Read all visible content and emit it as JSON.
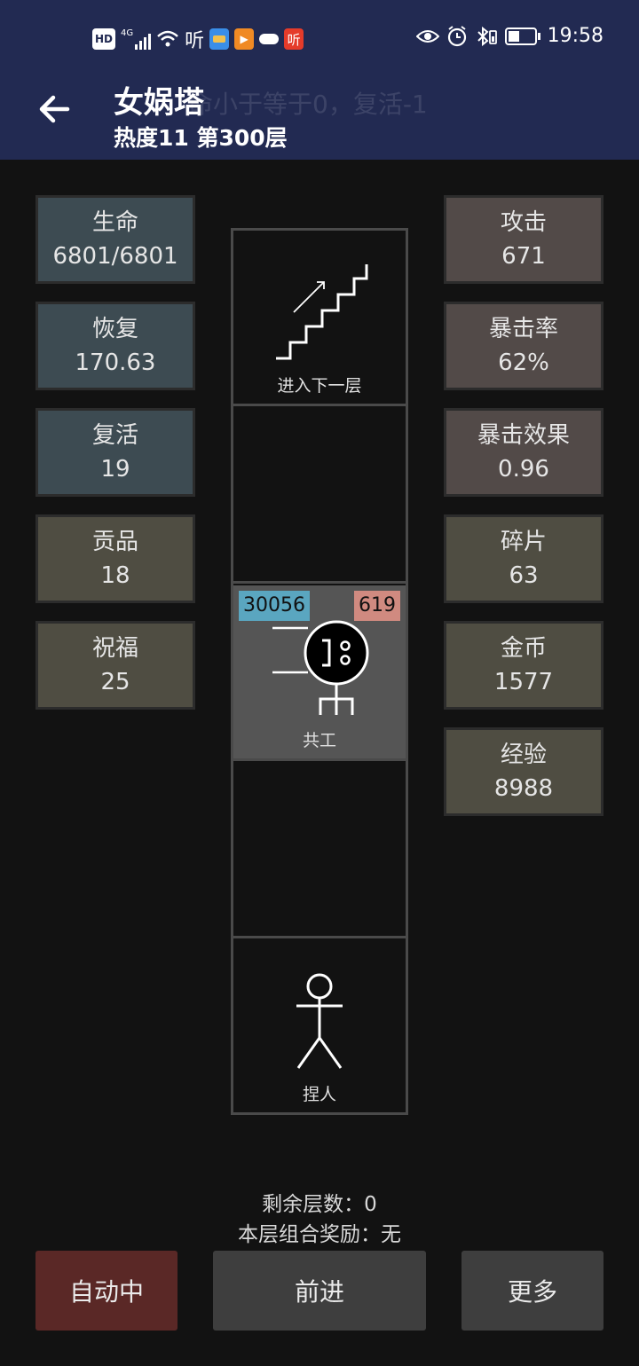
{
  "status_bar": {
    "left_icons": [
      "hd-icon",
      "4g-signal-icon",
      "wifi-icon",
      "listen-app-icon",
      "wallet-app-icon",
      "video-app-icon",
      "cloud-icon",
      "listen-red-app-icon"
    ],
    "hd": "HD",
    "net": "4G",
    "listen": "听",
    "time": "19:58",
    "right_icons": [
      "eye-icon",
      "alarm-icon",
      "bluetooth-icon",
      "battery-icon"
    ]
  },
  "header": {
    "title": "女娲塔",
    "ghost_text": "命小于等于0，复活-1",
    "subtitle": "热度11 第300层"
  },
  "left_stats": [
    {
      "label": "生命",
      "value": "6801/6801",
      "color": "#3d4b52"
    },
    {
      "label": "恢复",
      "value": "170.63",
      "color": "#3d4b52"
    },
    {
      "label": "复活",
      "value": "19",
      "color": "#3d4b52"
    },
    {
      "label": "贡品",
      "value": "18",
      "color": "#4f4d42"
    },
    {
      "label": "祝福",
      "value": "25",
      "color": "#4f4d42"
    }
  ],
  "right_stats": [
    {
      "label": "攻击",
      "value": "671",
      "color": "#524a48"
    },
    {
      "label": "暴击率",
      "value": "62%",
      "color": "#524a48"
    },
    {
      "label": "暴击效果",
      "value": "0.96",
      "color": "#524a48"
    },
    {
      "label": "碎片",
      "value": "63",
      "color": "#4f4d42"
    },
    {
      "label": "金币",
      "value": "1577",
      "color": "#4f4d42"
    },
    {
      "label": "经验",
      "value": "8988",
      "color": "#4f4d42"
    }
  ],
  "tower": {
    "stairs_label": "进入下一层",
    "enemy": {
      "name": "共工",
      "hp": "30056",
      "attack": "619"
    },
    "player_label": "捏人"
  },
  "info": {
    "remaining": "剩余层数：0",
    "reward": "本层组合奖励：无"
  },
  "buttons": {
    "auto": "自动中",
    "advance": "前进",
    "more": "更多"
  },
  "colors": {
    "header_bg": "#222a52",
    "hp_badge": "#5aa6c0",
    "atk_badge": "#d08a80",
    "auto_button": "#5a2826",
    "gray_button": "#3e3e3e"
  }
}
